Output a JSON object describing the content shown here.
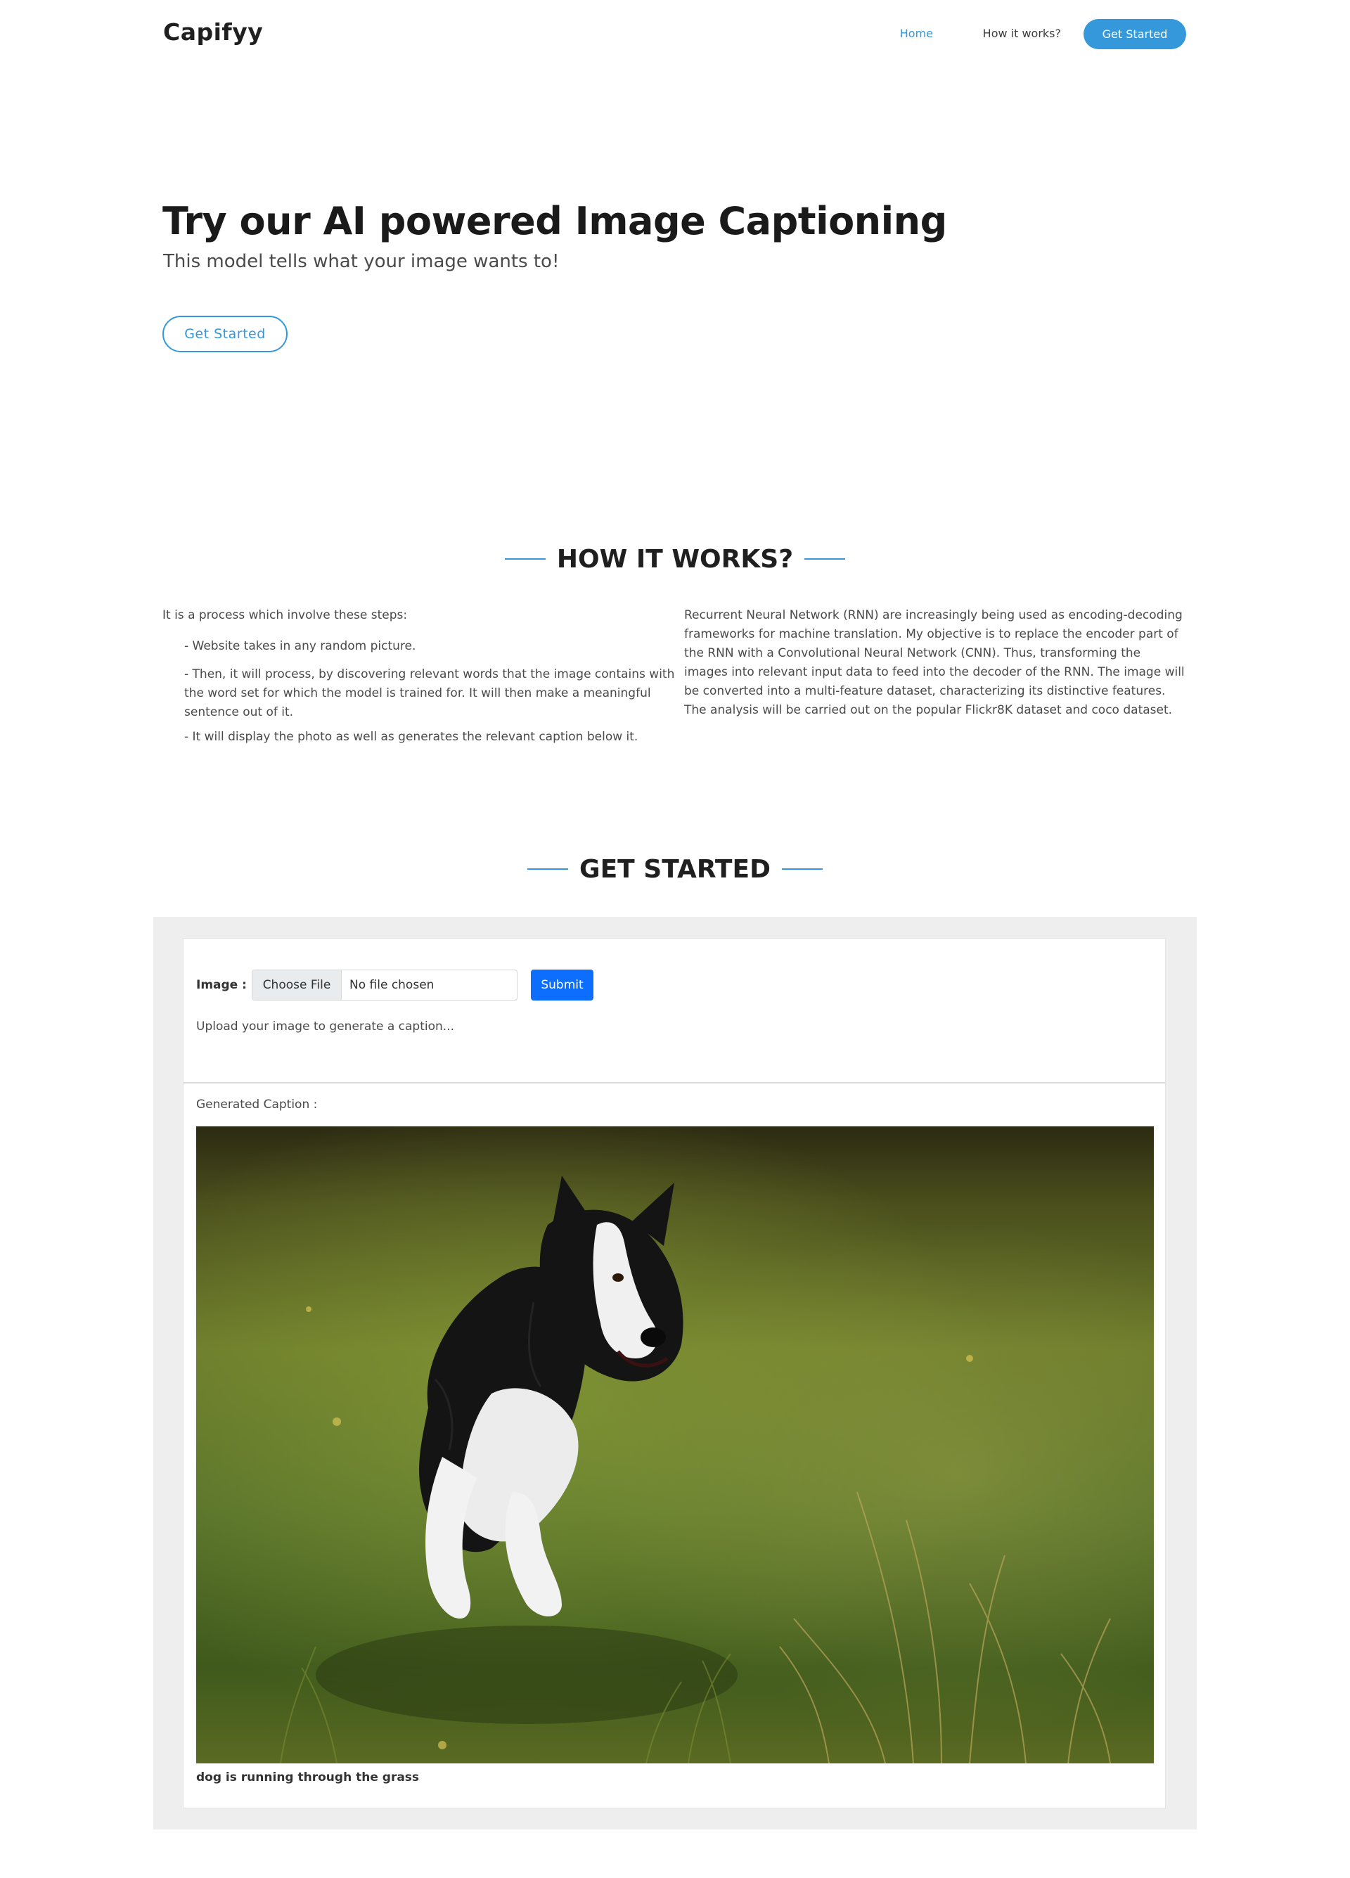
{
  "header": {
    "logo": "Capifyy",
    "nav": {
      "home": "Home",
      "how": "How it works?",
      "cta": "Get Started"
    }
  },
  "hero": {
    "title": "Try our AI powered Image Captioning",
    "subtitle": "This model tells what your image wants to!",
    "button": "Get Started"
  },
  "how_it_works": {
    "title": "HOW IT WORKS?",
    "intro": "It is a process which involve these steps:",
    "steps": [
      "- Website takes in any random picture.",
      "- Then, it will process, by discovering relevant words that the image contains with the word set for which the model is trained for. It will then make a meaningful sentence out of it.",
      "- It will display the photo as well as generates the relevant caption below it."
    ],
    "description": "Recurrent Neural Network (RNN) are increasingly being used as encoding-decoding frameworks for machine translation. My objective is to replace the encoder part of the RNN with a Convolutional Neural Network (CNN). Thus, transforming the images into relevant input data to feed into the decoder of the RNN. The image will be converted into a multi-feature dataset, characterizing its distinctive features. The analysis will be carried out on the popular Flickr8K dataset and coco dataset."
  },
  "get_started": {
    "title": "GET STARTED",
    "image_label": "Image :",
    "file_button": "Choose File",
    "file_name": "No file chosen",
    "submit": "Submit",
    "hint": "Upload your image to generate a caption...",
    "generated_label": "Generated Caption :",
    "caption": "dog is running through the grass"
  },
  "colors": {
    "accent": "#3498db",
    "submit": "#0d6efd",
    "panel_bg": "#eeeeee"
  }
}
